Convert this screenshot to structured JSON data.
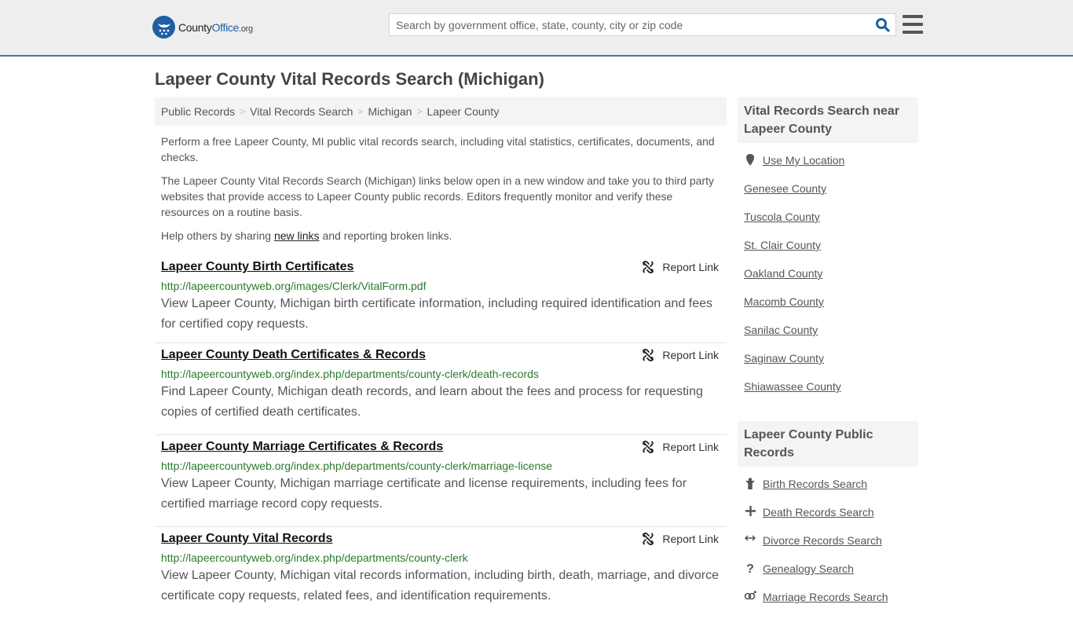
{
  "header": {
    "logo": {
      "part1": "County",
      "part2": "Office",
      "part3": ".org"
    },
    "search_placeholder": "Search by government office, state, county, city or zip code",
    "search_value": ""
  },
  "page": {
    "title": "Lapeer County Vital Records Search (Michigan)"
  },
  "breadcrumb": [
    "Public Records",
    "Vital Records Search",
    "Michigan",
    "Lapeer County"
  ],
  "intro": {
    "p1": "Perform a free Lapeer County, MI public vital records search, including vital statistics, certificates, documents, and checks.",
    "p2": "The Lapeer County Vital Records Search (Michigan) links below open in a new window and take you to third party websites that provide access to Lapeer County public records. Editors frequently monitor and verify these resources on a routine basis.",
    "p3_before": "Help others by sharing ",
    "p3_link": "new links",
    "p3_after": " and reporting broken links."
  },
  "results": [
    {
      "title": "Lapeer County Birth Certificates",
      "report_label": "Report Link",
      "url": "http://lapeercountyweb.org/images/Clerk/VitalForm.pdf",
      "description": "View Lapeer County, Michigan birth certificate information, including required identification and fees for certified copy requests."
    },
    {
      "title": "Lapeer County Death Certificates & Records",
      "report_label": "Report Link",
      "url": "http://lapeercountyweb.org/index.php/departments/county-clerk/death-records",
      "description": "Find Lapeer County, Michigan death records, and learn about the fees and process for requesting copies of certified death certificates."
    },
    {
      "title": "Lapeer County Marriage Certificates & Records",
      "report_label": "Report Link",
      "url": "http://lapeercountyweb.org/index.php/departments/county-clerk/marriage-license",
      "description": "View Lapeer County, Michigan marriage certificate and license requirements, including fees for certified marriage record copy requests."
    },
    {
      "title": "Lapeer County Vital Records",
      "report_label": "Report Link",
      "url": "http://lapeercountyweb.org/index.php/departments/county-clerk",
      "description": "View Lapeer County, Michigan vital records information, including birth, death, marriage, and divorce certificate copy requests, related fees, and identification requirements."
    }
  ],
  "sidebar": {
    "nearby": {
      "heading": "Vital Records Search near Lapeer County",
      "use_location": "Use My Location",
      "counties": [
        "Genesee County",
        "Tuscola County",
        "St. Clair County",
        "Oakland County",
        "Macomb County",
        "Sanilac County",
        "Saginaw County",
        "Shiawassee County"
      ]
    },
    "public_records": {
      "heading": "Lapeer County Public Records",
      "items": [
        {
          "icon": "birth-icon",
          "glyph": "ὫC",
          "label": "Birth Records Search"
        },
        {
          "icon": "plus-icon",
          "glyph": "+",
          "label": "Death Records Search"
        },
        {
          "icon": "arrows-horizontal-icon",
          "glyph": "↔",
          "label": "Divorce Records Search"
        },
        {
          "icon": "question-icon",
          "glyph": "?",
          "label": "Genealogy Search"
        },
        {
          "icon": "marriage-icon",
          "glyph": "⚤",
          "label": "Marriage Records Search"
        }
      ]
    }
  },
  "colors": {
    "brand_blue": "#1e5fa3",
    "header_border": "#3e7aab",
    "url_green": "#2c7a2c"
  }
}
